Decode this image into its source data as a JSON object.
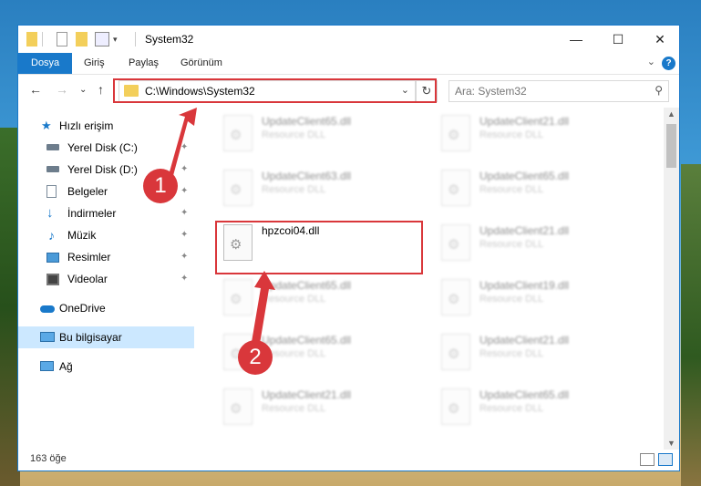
{
  "window": {
    "title": "System32",
    "minimize": "—",
    "maximize": "☐",
    "close": "✕"
  },
  "ribbon": {
    "tabs": [
      "Dosya",
      "Giriş",
      "Paylaş",
      "Görünüm"
    ],
    "help": "?",
    "collapse": "⌄"
  },
  "nav": {
    "back": "←",
    "forward": "→",
    "recent": "⌄",
    "up": "↑",
    "address": "C:\\Windows\\System32",
    "address_dropdown": "⌄",
    "refresh": "↻",
    "search_placeholder": "Ara: System32",
    "search_icon": "⚲"
  },
  "sidebar": {
    "quick_access": "Hızlı erişim",
    "items": [
      {
        "label": "Yerel Disk (C:)",
        "icon": "drive-icon"
      },
      {
        "label": "Yerel Disk (D:)",
        "icon": "drive-icon"
      },
      {
        "label": "Belgeler",
        "icon": "documents-icon"
      },
      {
        "label": "İndirmeler",
        "icon": "download-icon"
      },
      {
        "label": "Müzik",
        "icon": "music-icon"
      },
      {
        "label": "Resimler",
        "icon": "pictures-icon"
      },
      {
        "label": "Videolar",
        "icon": "videos-icon"
      }
    ],
    "onedrive": "OneDrive",
    "this_pc": "Bu bilgisayar",
    "network": "Ağ",
    "pin": "📌"
  },
  "files": {
    "left": [
      {
        "name": "UpdateClient65.dll",
        "desc": "Resource DLL"
      },
      {
        "name": "UpdateClient63.dll",
        "desc": "Resource DLL"
      },
      {
        "name": "hpzcoi04.dll",
        "desc": ""
      },
      {
        "name": "UpdateClient65.dll",
        "desc": "Resource DLL"
      },
      {
        "name": "UpdateClient65.dll",
        "desc": "Resource DLL"
      },
      {
        "name": "UpdateClient21.dll",
        "desc": "Resource DLL"
      }
    ],
    "right": [
      {
        "name": "UpdateClient21.dll",
        "desc": "Resource DLL"
      },
      {
        "name": "UpdateClient65.dll",
        "desc": "Resource DLL"
      },
      {
        "name": "UpdateClient21.dll",
        "desc": "Resource DLL"
      },
      {
        "name": "UpdateClient19.dll",
        "desc": "Resource DLL"
      },
      {
        "name": "UpdateClient21.dll",
        "desc": "Resource DLL"
      },
      {
        "name": "UpdateClient65.dll",
        "desc": "Resource DLL"
      }
    ]
  },
  "status": {
    "count": "163 öğe"
  },
  "annotations": {
    "step1": "1",
    "step2": "2",
    "color": "#d9373b"
  }
}
